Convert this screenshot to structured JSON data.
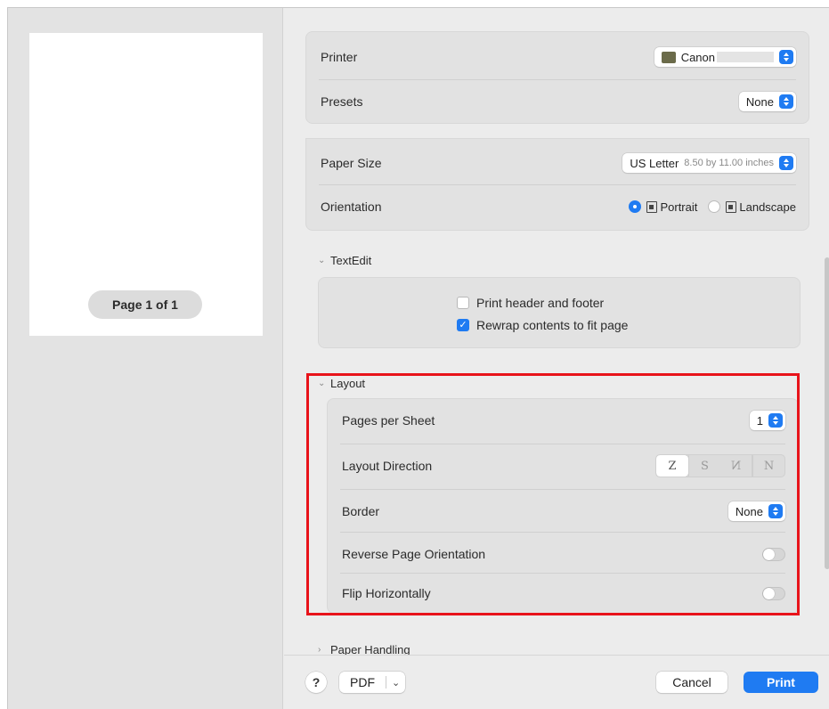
{
  "preview": {
    "page_indicator": "Page 1 of 1"
  },
  "printer": {
    "label": "Printer",
    "value": "Canon",
    "icon": "printer-icon"
  },
  "presets": {
    "label": "Presets",
    "value": "None"
  },
  "paper_size": {
    "label": "Paper Size",
    "value": "US Letter",
    "detail": "8.50 by 11.00 inches"
  },
  "orientation": {
    "label": "Orientation",
    "options": [
      "Portrait",
      "Landscape"
    ],
    "selected": "Portrait"
  },
  "textedit": {
    "title": "TextEdit",
    "print_header_footer": {
      "label": "Print header and footer",
      "checked": false
    },
    "rewrap_contents": {
      "label": "Rewrap contents to fit page",
      "checked": true
    }
  },
  "layout": {
    "title": "Layout",
    "pages_per_sheet": {
      "label": "Pages per Sheet",
      "value": "1"
    },
    "layout_direction": {
      "label": "Layout Direction",
      "options": [
        "Z",
        "S",
        "N",
        "N"
      ],
      "selected_index": 0
    },
    "border": {
      "label": "Border",
      "value": "None"
    },
    "reverse_page_orientation": {
      "label": "Reverse Page Orientation",
      "on": false
    },
    "flip_horizontally": {
      "label": "Flip Horizontally",
      "on": false
    }
  },
  "paper_handling": {
    "title": "Paper Handling"
  },
  "footer": {
    "help": "?",
    "pdf_label": "PDF",
    "cancel_label": "Cancel",
    "print_label": "Print"
  },
  "colors": {
    "accent": "#1f7bf2",
    "highlight": "#e8131a"
  }
}
